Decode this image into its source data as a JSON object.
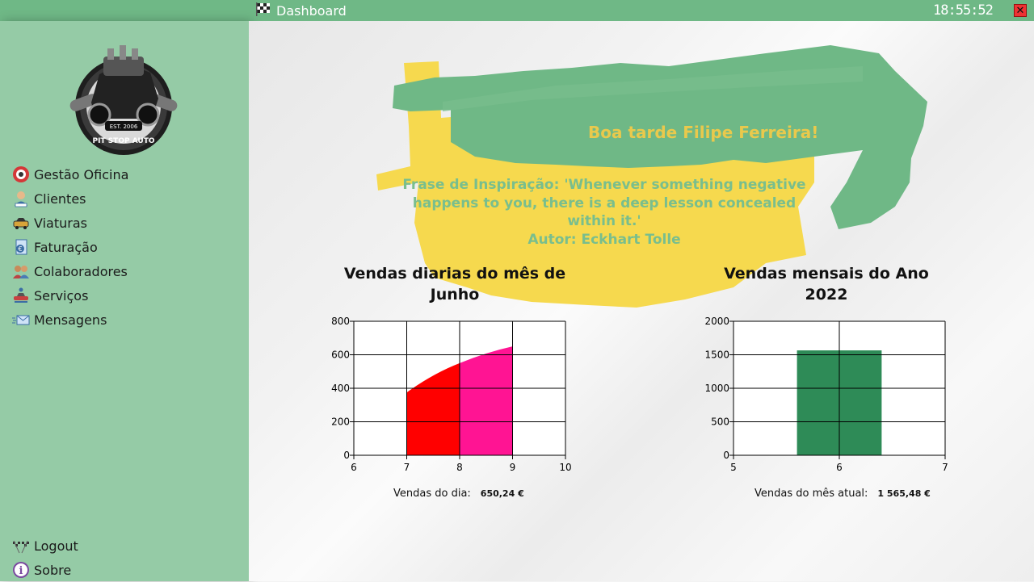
{
  "window": {
    "title": "Dashboard",
    "clock": "18:55:52",
    "close_label": "✕"
  },
  "sidebar": {
    "logo_text": "PIT STOP AUTO",
    "logo_est": "EST. 2006",
    "items": [
      {
        "label": "Gestão Oficina",
        "icon": "workshop-icon"
      },
      {
        "label": "Clientes",
        "icon": "client-icon"
      },
      {
        "label": "Viaturas",
        "icon": "car-icon"
      },
      {
        "label": "Faturação",
        "icon": "invoice-icon"
      },
      {
        "label": "Colaboradores",
        "icon": "team-icon"
      },
      {
        "label": "Serviços",
        "icon": "service-icon"
      },
      {
        "label": "Mensagens",
        "icon": "mail-icon"
      }
    ],
    "bottom_items": [
      {
        "label": "Logout",
        "icon": "logout-icon"
      },
      {
        "label": "Sobre",
        "icon": "info-icon"
      }
    ]
  },
  "main": {
    "greeting": "Boa tarde Filipe Ferreira!",
    "quote": "Frase de Inspiração: 'Whenever something negative happens to you, there is a deep lesson concealed within it.'",
    "author": "Autor: Eckhart Tolle",
    "colors": {
      "brush_green": "#6fb886",
      "brush_yellow": "#f6d94e"
    }
  },
  "daily": {
    "title": "Vendas diarias do mês de Junho",
    "stat_label": "Vendas do dia:",
    "stat_value": "650,24 €"
  },
  "monthly": {
    "title": "Vendas mensais do Ano 2022",
    "stat_label": "Vendas do mês atual:",
    "stat_value": "1 565,48 €"
  },
  "chart_data": [
    {
      "type": "area",
      "title": "Vendas diarias do mês de Junho",
      "xlim": [
        6,
        10
      ],
      "ylim": [
        0,
        800
      ],
      "x_ticks": [
        6,
        7,
        8,
        9,
        10
      ],
      "y_ticks": [
        0,
        200,
        400,
        600,
        800
      ],
      "grid": true,
      "series": [
        {
          "x": [
            7,
            8
          ],
          "y": [
            375,
            550
          ],
          "color": "#ff0000"
        },
        {
          "x": [
            8,
            9
          ],
          "y": [
            550,
            650
          ],
          "color": "#ff1493"
        }
      ]
    },
    {
      "type": "bar",
      "title": "Vendas mensais do Ano 2022",
      "xlim": [
        5,
        7
      ],
      "ylim": [
        0,
        2000
      ],
      "x_ticks": [
        5,
        6,
        7
      ],
      "y_ticks": [
        0,
        500,
        1000,
        1500,
        2000
      ],
      "grid": true,
      "categories": [
        6
      ],
      "values": [
        1565.48
      ],
      "color": "#2e8b57"
    }
  ]
}
